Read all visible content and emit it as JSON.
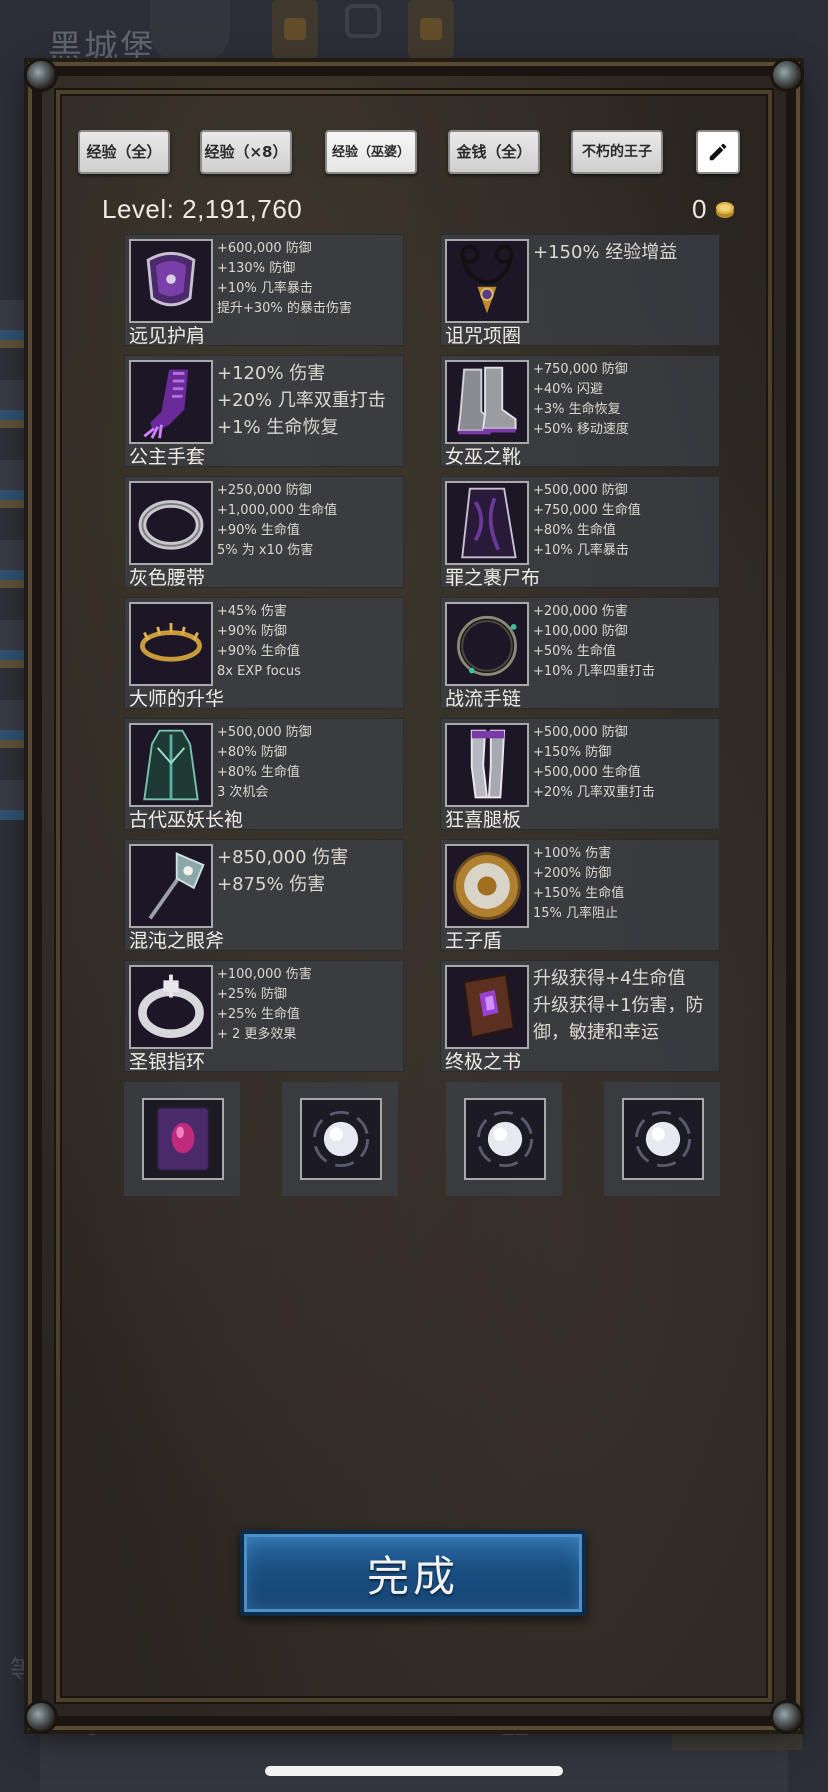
{
  "background": {
    "title": "黑城堡",
    "bottom_left_number": "0",
    "bottom_right_number": "11",
    "bottom_left_char": "等"
  },
  "top_buttons": {
    "exp_all": "经验（全）",
    "exp_x8": "经验（×8）",
    "exp_witch": "经验（巫婆）",
    "gold_all": "金钱（全）",
    "immortal_prince": "不朽的王子",
    "edit_icon": "pencil-icon"
  },
  "level": {
    "text": "Level:  2,191,760",
    "gold": "0"
  },
  "items": [
    {
      "name": "远见护肩",
      "icon": "shoulder-guard-icon",
      "stats": [
        "+600,000 防御",
        "+130% 防御",
        "+10% 几率暴击",
        "提升+30% 的暴击伤害"
      ]
    },
    {
      "name": "诅咒项圈",
      "icon": "cursed-necklace-icon",
      "stats": [
        "+150% 经验增益"
      ]
    },
    {
      "name": "公主手套",
      "icon": "princess-glove-icon",
      "stats": [
        "+120% 伤害",
        "+20% 几率双重打击",
        "+1% 生命恢复"
      ]
    },
    {
      "name": "女巫之靴",
      "icon": "witch-boots-icon",
      "stats": [
        "+750,000 防御",
        "+40% 闪避",
        "+3% 生命恢复",
        "+50% 移动速度"
      ]
    },
    {
      "name": "灰色腰带",
      "icon": "grey-belt-icon",
      "stats": [
        "+250,000 防御",
        "+1,000,000 生命值",
        "+90% 生命值",
        "5% 为 x10 伤害"
      ]
    },
    {
      "name": "罪之裹尸布",
      "icon": "shroud-icon",
      "stats": [
        "+500,000 防御",
        "+750,000 生命值",
        "+80% 生命值",
        "+10% 几率暴击"
      ]
    },
    {
      "name": "大师的升华",
      "icon": "circlet-icon",
      "stats": [
        "+45% 伤害",
        "+90% 防御",
        "+90% 生命值",
        "8x EXP focus"
      ]
    },
    {
      "name": "战流手链",
      "icon": "bracelet-icon",
      "stats": [
        "+200,000 伤害",
        "+100,000 防御",
        "+50% 生命值",
        "+10% 几率四重打击"
      ]
    },
    {
      "name": "古代巫妖长袍",
      "icon": "lich-robe-icon",
      "stats": [
        "+500,000 防御",
        "+80% 防御",
        "+80% 生命值",
        "3 次机会"
      ]
    },
    {
      "name": "狂喜腿板",
      "icon": "greaves-icon",
      "stats": [
        "+500,000 防御",
        "+150% 防御",
        "+500,000 生命值",
        "+20% 几率双重打击"
      ]
    },
    {
      "name": "混沌之眼斧",
      "icon": "axe-icon",
      "stats": [
        "+850,000 伤害",
        "+875% 伤害"
      ]
    },
    {
      "name": "王子盾",
      "icon": "shield-icon",
      "stats": [
        "+100% 伤害",
        "+200% 防御",
        "+150% 生命值",
        "15% 几率阻止"
      ]
    },
    {
      "name": "圣银指环",
      "icon": "silver-ring-icon",
      "stats": [
        "+100,000 伤害",
        "+25% 防御",
        "+25% 生命值",
        "+ 2 更多效果"
      ]
    },
    {
      "name": "终极之书",
      "icon": "book-icon",
      "stats": [
        "升级获得+4生命值",
        "升级获得+1伤害，防御，敏捷和幸运"
      ]
    }
  ],
  "slots": [
    {
      "icon": "purple-tome-icon"
    },
    {
      "icon": "pearl-orb-icon"
    },
    {
      "icon": "pearl-orb-icon"
    },
    {
      "icon": "pearl-orb-icon"
    }
  ],
  "done_button": "完成",
  "colors": {
    "done_button": "#1a4f82",
    "card_bg": "#3c4048",
    "panel_bg": "#2f2a23"
  }
}
